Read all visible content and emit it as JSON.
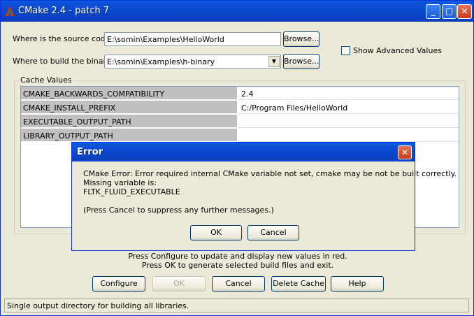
{
  "window": {
    "title": "CMake 2.4 - patch 7",
    "minimize_glyph": "_",
    "maximize_glyph": "□",
    "close_glyph": "✕"
  },
  "source": {
    "label": "Where is the source code:",
    "value": "E:\\somin\\Examples\\HelloWorld",
    "browse_label": "Browse..."
  },
  "build": {
    "label": "Where to build the binaries:",
    "value": "E:\\somin\\Examples\\h-binary",
    "browse_label": "Browse...",
    "dropdown_glyph": "▼"
  },
  "advanced": {
    "label": "Show Advanced Values",
    "checked": false
  },
  "cache": {
    "legend": "Cache Values",
    "rows": [
      {
        "key": "CMAKE_BACKWARDS_COMPATIBILITY",
        "value": "2.4"
      },
      {
        "key": "CMAKE_INSTALL_PREFIX",
        "value": "C:/Program Files/HelloWorld"
      },
      {
        "key": "EXECUTABLE_OUTPUT_PATH",
        "value": ""
      },
      {
        "key": "LIBRARY_OUTPUT_PATH",
        "value": ""
      }
    ]
  },
  "hints": {
    "line1": "Press Configure to update and display new values in red.",
    "line2": "Press OK to generate selected build files and exit."
  },
  "buttons": {
    "configure": "Configure",
    "ok": "OK",
    "cancel": "Cancel",
    "delete_cache": "Delete Cache",
    "help": "Help"
  },
  "status": "Single output directory for building all libraries.",
  "dialog": {
    "title": "Error",
    "close_glyph": "✕",
    "line1": "CMake Error: Error required internal CMake variable not set, cmake may be not be built correctly.",
    "line2": "Missing variable is:",
    "line3": "FLTK_FLUID_EXECUTABLE",
    "line4": "(Press  Cancel to suppress any further messages.)",
    "ok_label": "OK",
    "cancel_label": "Cancel"
  },
  "colors": {
    "titlebar": "#0a4fd8",
    "face": "#ece9d8",
    "key_cell": "#c0c0c0"
  }
}
